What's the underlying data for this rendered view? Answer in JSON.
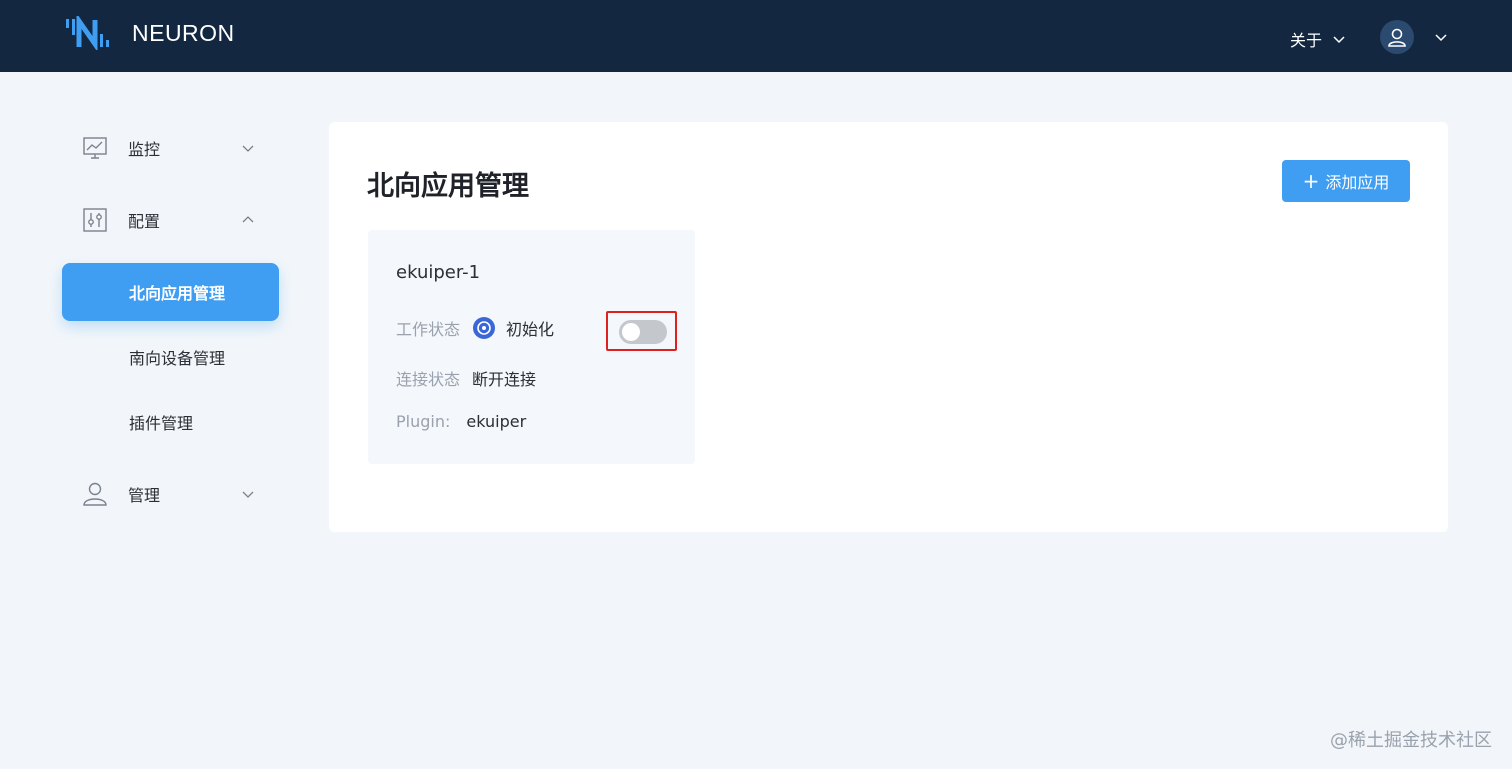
{
  "header": {
    "logo_text": "NEURON",
    "about_label": "关于"
  },
  "sidebar": {
    "groups": [
      {
        "label": "监控",
        "icon": "chart-monitor-icon",
        "expanded": false
      },
      {
        "label": "配置",
        "icon": "sliders-icon",
        "expanded": true,
        "items": [
          {
            "label": "北向应用管理",
            "active": true
          },
          {
            "label": "南向设备管理",
            "active": false
          },
          {
            "label": "插件管理",
            "active": false
          }
        ]
      },
      {
        "label": "管理",
        "icon": "user-icon",
        "expanded": false
      }
    ]
  },
  "main": {
    "title": "北向应用管理",
    "add_button_label": "添加应用",
    "card": {
      "name": "ekuiper-1",
      "work_status_label": "工作状态",
      "work_status_value": "初始化",
      "connection_status_label": "连接状态",
      "connection_status_value": "断开连接",
      "plugin_label": "Plugin:",
      "plugin_value": "ekuiper",
      "enabled": false
    }
  },
  "watermark": "@稀土掘金技术社区",
  "colors": {
    "header_bg": "#132840",
    "accent": "#3f9df2",
    "page_bg": "#f2f6fa",
    "highlight_border": "#e01f1f"
  }
}
